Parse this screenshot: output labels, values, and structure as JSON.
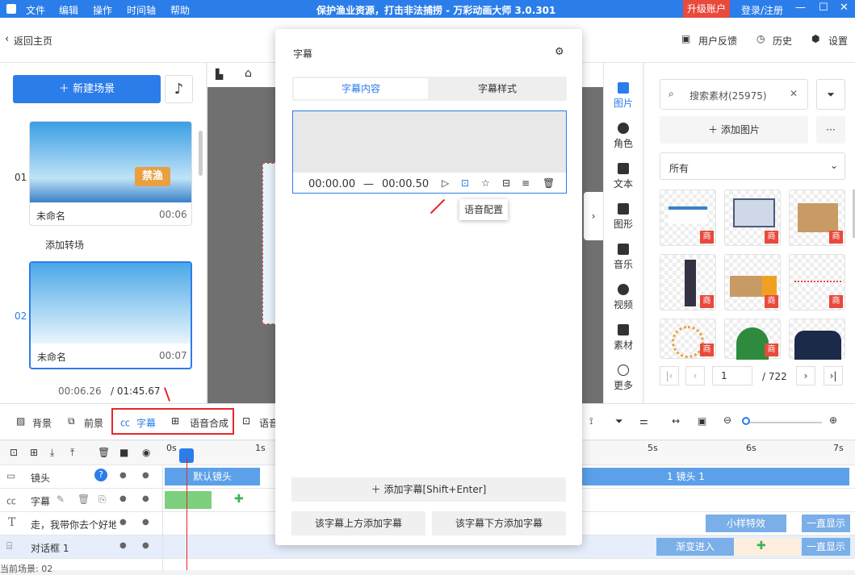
{
  "titlebar": {
    "menus": [
      "文件",
      "编辑",
      "操作",
      "时间轴",
      "帮助"
    ],
    "title": "保护渔业资源，打击非法捕捞 - 万彩动画大师 3.0.301",
    "upgrade": "升级账户",
    "login": "登录/注册"
  },
  "subbar": {
    "back": "返回主页",
    "feedback": "用户反馈",
    "history": "历史",
    "settings": "设置"
  },
  "left": {
    "new_scene": "新建场景",
    "scenes": [
      {
        "num": "01",
        "name": "未命名",
        "time": "00:06"
      },
      {
        "num": "02",
        "name": "未命名",
        "time": "00:07"
      }
    ],
    "add_transition": "添加转场",
    "cur_time": "00:06.26",
    "total_time": "/ 01:45.67",
    "thumb1_text": "禁渔"
  },
  "popup": {
    "title": "字幕",
    "tab_content": "字幕内容",
    "tab_style": "字幕样式",
    "start": "00:00.00",
    "dash": "—",
    "end": "00:00.50",
    "tooltip": "语音配置",
    "add_sub": "添加字幕[Shift+Enter]",
    "add_above": "该字幕上方添加字幕",
    "add_below": "该字幕下方添加字幕"
  },
  "right_nav": [
    {
      "label": "图片"
    },
    {
      "label": "角色"
    },
    {
      "label": "文本"
    },
    {
      "label": "图形"
    },
    {
      "label": "音乐"
    },
    {
      "label": "视频"
    },
    {
      "label": "素材"
    },
    {
      "label": "更多"
    }
  ],
  "material": {
    "search_placeholder": "搜索素材(25975)",
    "add_image": "添加图片",
    "filter": "所有",
    "badge": "商",
    "page": "1",
    "total_pages": "/ 722"
  },
  "toolbar": {
    "background": "背景",
    "foreground": "前景",
    "subtitle": "字幕",
    "tts": "语音合成",
    "voice": "语音"
  },
  "timeline": {
    "ticks": [
      "0s",
      "1s",
      "5s",
      "6s",
      "7s"
    ],
    "rows": [
      {
        "label": "镜头"
      },
      {
        "label": "字幕"
      },
      {
        "label": "走，我带你去个好地"
      },
      {
        "label": "对话框 1"
      }
    ],
    "default_lens": "默认镜头",
    "lens1": "1 镜头 1",
    "effect": "小样特效",
    "always": "一直显示",
    "fade_in": "渐变进入",
    "always2": "一直显示",
    "current_scene": "当前场景: 02"
  },
  "colors": {
    "accent": "#2b7de9",
    "red": "#e84a3c",
    "green": "#7dd07d"
  }
}
